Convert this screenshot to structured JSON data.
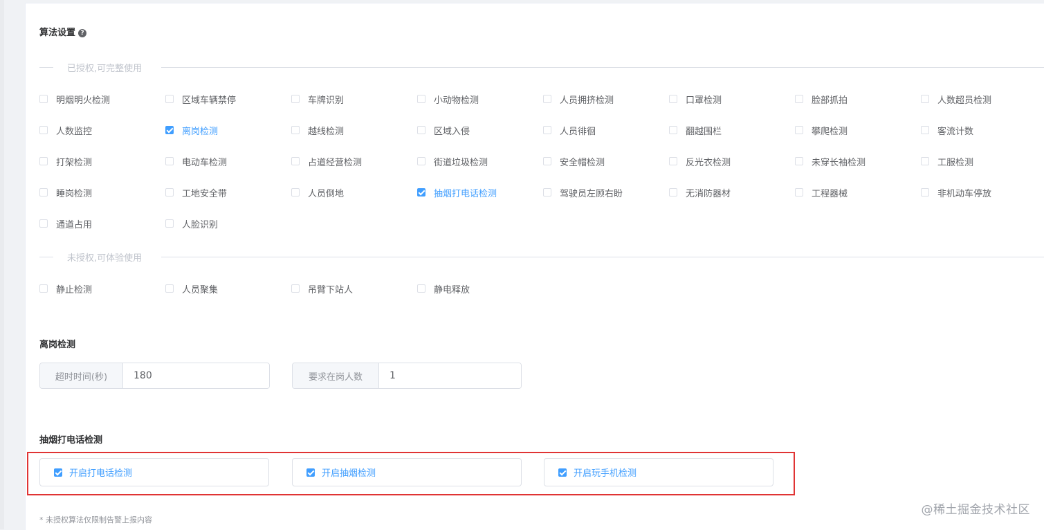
{
  "title": "算法设置",
  "help_icon": "question-circle-icon",
  "authorized_divider": "已授权,可完整使用",
  "authorized": [
    {
      "label": "明烟明火检测",
      "checked": false
    },
    {
      "label": "区域车辆禁停",
      "checked": false
    },
    {
      "label": "车牌识别",
      "checked": false
    },
    {
      "label": "小动物检测",
      "checked": false
    },
    {
      "label": "人员拥挤检测",
      "checked": false
    },
    {
      "label": "口罩检测",
      "checked": false
    },
    {
      "label": "脸部抓拍",
      "checked": false
    },
    {
      "label": "人数超员检测",
      "checked": false
    },
    {
      "label": "人数监控",
      "checked": false
    },
    {
      "label": "离岗检测",
      "checked": true
    },
    {
      "label": "越线检测",
      "checked": false
    },
    {
      "label": "区域入侵",
      "checked": false
    },
    {
      "label": "人员徘徊",
      "checked": false
    },
    {
      "label": "翻越围栏",
      "checked": false
    },
    {
      "label": "攀爬检测",
      "checked": false
    },
    {
      "label": "客流计数",
      "checked": false
    },
    {
      "label": "打架检测",
      "checked": false
    },
    {
      "label": "电动车检测",
      "checked": false
    },
    {
      "label": "占道经营检测",
      "checked": false
    },
    {
      "label": "街道垃圾检测",
      "checked": false
    },
    {
      "label": "安全帽检测",
      "checked": false
    },
    {
      "label": "反光衣检测",
      "checked": false
    },
    {
      "label": "未穿长袖检测",
      "checked": false
    },
    {
      "label": "工服检测",
      "checked": false
    },
    {
      "label": "睡岗检测",
      "checked": false
    },
    {
      "label": "工地安全带",
      "checked": false
    },
    {
      "label": "人员倒地",
      "checked": false
    },
    {
      "label": "抽烟打电话检测",
      "checked": true
    },
    {
      "label": "驾驶员左顾右盼",
      "checked": false
    },
    {
      "label": "无消防器材",
      "checked": false
    },
    {
      "label": "工程器械",
      "checked": false
    },
    {
      "label": "非机动车停放",
      "checked": false
    },
    {
      "label": "通道占用",
      "checked": false
    },
    {
      "label": "人脸识别",
      "checked": false
    }
  ],
  "unauthorized_divider": "未授权,可体验使用",
  "unauthorized": [
    {
      "label": "静止检测",
      "checked": false
    },
    {
      "label": "人员聚集",
      "checked": false
    },
    {
      "label": "吊臂下站人",
      "checked": false
    },
    {
      "label": "静电释放",
      "checked": false
    }
  ],
  "leave_post": {
    "title": "离岗检测",
    "timeout_label": "超时时间(秒)",
    "timeout_value": "180",
    "required_label": "要求在岗人数",
    "required_value": "1"
  },
  "smoke_phone": {
    "title": "抽烟打电话检测",
    "options": [
      {
        "label": "开启打电话检测",
        "checked": true
      },
      {
        "label": "开启抽烟检测",
        "checked": true
      },
      {
        "label": "开启玩手机检测",
        "checked": true
      }
    ]
  },
  "accent_color": "#409eff",
  "highlight_color": "#e03434",
  "footnote": "* 未授权算法仅限制告警上报内容",
  "watermark": "@稀土掘金技术社区"
}
